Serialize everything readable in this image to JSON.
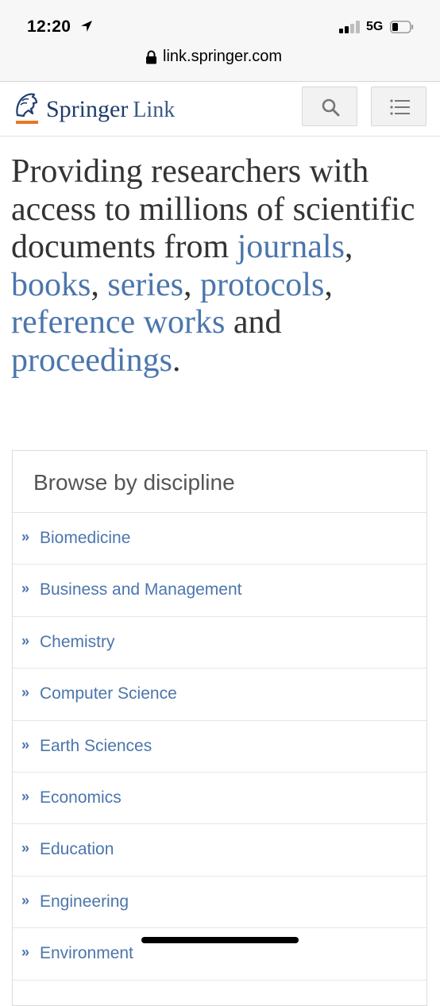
{
  "status_bar": {
    "time": "12:20",
    "network": "5G",
    "icons": [
      "location-arrow-icon",
      "signal-bars-icon",
      "battery-icon"
    ]
  },
  "url_bar": {
    "url": "link.springer.com",
    "icon": "lock-icon"
  },
  "header": {
    "logo_primary": "Springer",
    "logo_secondary": "Link",
    "logo_icon": "springer-horse-icon",
    "accent_color": "#e87722",
    "search_icon": "search-icon",
    "menu_icon": "menu-list-icon"
  },
  "hero": {
    "text_1": "Providing researchers with access to millions of scientific documents from ",
    "link_journals": "journals",
    "comma_1": ", ",
    "link_books": "books",
    "comma_2": ", ",
    "link_series": "series",
    "comma_3": ", ",
    "link_protocols": "protocols",
    "comma_4": ", ",
    "link_reference_works": "reference works",
    "and_text": " and ",
    "link_proceedings": "proceedings",
    "period": "."
  },
  "browse": {
    "title": "Browse by discipline",
    "bullet": "»",
    "items": [
      "Biomedicine",
      "Business and Management",
      "Chemistry",
      "Computer Science",
      "Earth Sciences",
      "Economics",
      "Education",
      "Engineering",
      "Environment"
    ]
  },
  "colors": {
    "link": "#4b76ac",
    "brand_navy": "#1e3d6b",
    "text": "#333333"
  }
}
